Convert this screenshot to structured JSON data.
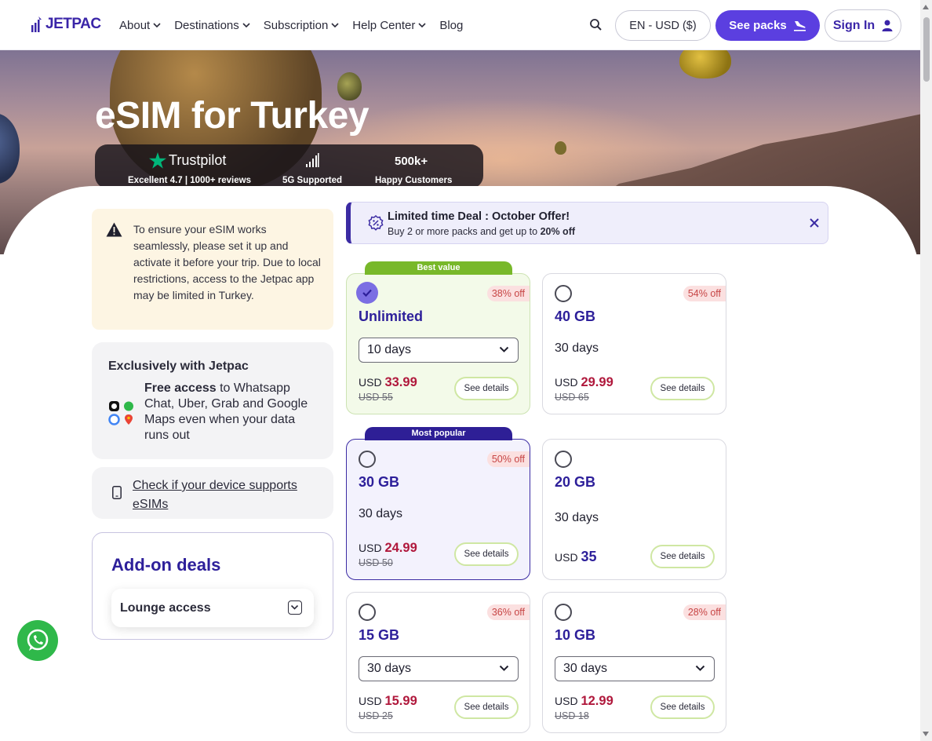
{
  "header": {
    "logo_text": "JETPAC",
    "nav": [
      {
        "label": "About"
      },
      {
        "label": "Destinations"
      },
      {
        "label": "Subscription"
      },
      {
        "label": "Help Center"
      },
      {
        "label": "Blog"
      }
    ],
    "language": "EN - USD ($)",
    "see_packs": "See packs",
    "sign_in": "Sign In"
  },
  "hero": {
    "title": "eSIM for Turkey",
    "trustpilot_name": "Trustpilot",
    "trustpilot_label": "Excellent 4.7 | 1000+ reviews",
    "network_label": "5G Supported",
    "customers_count": "500k+",
    "customers_label": "Happy Customers"
  },
  "warning": {
    "text": "To ensure your eSIM works seamlessly, please set it up and activate it before your trip. Due to local restrictions, access to the Jetpac app may be limited in Turkey."
  },
  "exclusive": {
    "title": "Exclusively with Jetpac",
    "bold": "Free access",
    "text": " to Whatsapp Chat, Uber, Grab and Google Maps even when your data runs out"
  },
  "device_check": {
    "link": "Check if your device supports eSIMs"
  },
  "addon": {
    "title": "Add-on deals",
    "item": "Lounge access"
  },
  "deal": {
    "title": "Limited time Deal : October Offer!",
    "desc_prefix": "Buy 2 or more packs and get up to ",
    "desc_bold": "20% off"
  },
  "packs": [
    {
      "name": "Unlimited",
      "ribbon": "Best value",
      "discount": "38% off",
      "days": "10 days",
      "currency": "USD",
      "price": "33.99",
      "old_price": "USD 55",
      "details": "See details",
      "selected": true
    },
    {
      "name": "40 GB",
      "discount": "54% off",
      "days": "30 days",
      "currency": "USD",
      "price": "29.99",
      "old_price": "USD 65",
      "details": "See details"
    },
    {
      "name": "30 GB",
      "ribbon": "Most popular",
      "discount": "50% off",
      "days": "30 days",
      "currency": "USD",
      "price": "24.99",
      "old_price": "USD 50",
      "details": "See details"
    },
    {
      "name": "20 GB",
      "days": "30 days",
      "currency": "USD",
      "price": "35",
      "details": "See details"
    },
    {
      "name": "15 GB",
      "discount": "36% off",
      "days": "30 days",
      "currency": "USD",
      "price": "15.99",
      "old_price": "USD 25",
      "details": "See details"
    },
    {
      "name": "10 GB",
      "discount": "28% off",
      "days": "30 days",
      "currency": "USD",
      "price": "12.99",
      "old_price": "USD 18",
      "details": "See details"
    }
  ],
  "colors": {
    "brand": "#3a25a8",
    "accent": "#5b3fe0",
    "price_red": "#b0183c",
    "best_value": "#78b82a",
    "most_popular": "#2e1f96"
  }
}
